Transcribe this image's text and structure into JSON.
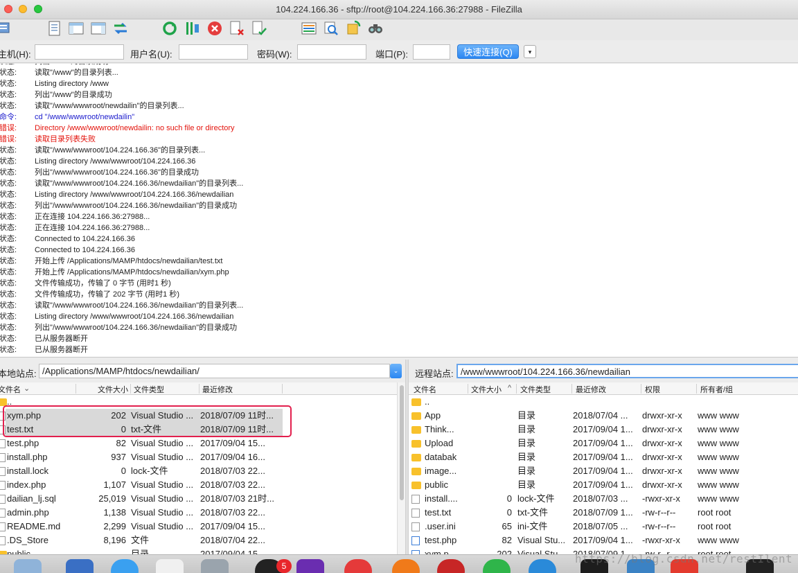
{
  "window": {
    "title": "104.224.166.36 - sftp://root@104.224.166.36:27988 - FileZilla"
  },
  "toolbar": {
    "icons": [
      "site-manager-icon",
      "message-log-icon",
      "local-tree-icon",
      "remote-tree-icon",
      "transfer-queue-icon",
      "refresh-icon",
      "process-queue-icon",
      "cancel-icon",
      "disconnect-icon",
      "reconnect-icon",
      "filter-icon",
      "compare-icon",
      "sync-browse-icon",
      "search-icon"
    ]
  },
  "quickconnect": {
    "host_label": "主机(H):",
    "user_label": "用户名(U):",
    "pass_label": "密码(W):",
    "port_label": "端口(P):",
    "host_value": "",
    "user_value": "",
    "pass_value": "",
    "port_value": "",
    "connect_label": "快速连接(Q)",
    "dropdown_glyph": "▾"
  },
  "log": [
    {
      "type": "状态:",
      "kind": "st",
      "msg": "列出\"/root\"的目录成功"
    },
    {
      "type": "状态:",
      "kind": "st",
      "msg": "读取\"/www\"的目录列表..."
    },
    {
      "type": "状态:",
      "kind": "st",
      "msg": "Listing directory /www"
    },
    {
      "type": "状态:",
      "kind": "st",
      "msg": "列出\"/www\"的目录成功"
    },
    {
      "type": "状态:",
      "kind": "st",
      "msg": "读取\"/www/wwwroot/newdailin\"的目录列表..."
    },
    {
      "type": "命令:",
      "kind": "cmd",
      "msg": "cd \"/www/wwwroot/newdailin\""
    },
    {
      "type": "错误:",
      "kind": "err",
      "msg": "Directory /www/wwwroot/newdailin: no such file or directory"
    },
    {
      "type": "错误:",
      "kind": "err",
      "msg": "读取目录列表失败"
    },
    {
      "type": "状态:",
      "kind": "st",
      "msg": "读取\"/www/wwwroot/104.224.166.36\"的目录列表..."
    },
    {
      "type": "状态:",
      "kind": "st",
      "msg": "Listing directory /www/wwwroot/104.224.166.36"
    },
    {
      "type": "状态:",
      "kind": "st",
      "msg": "列出\"/www/wwwroot/104.224.166.36\"的目录成功"
    },
    {
      "type": "状态:",
      "kind": "st",
      "msg": "读取\"/www/wwwroot/104.224.166.36/newdailian\"的目录列表..."
    },
    {
      "type": "状态:",
      "kind": "st",
      "msg": "Listing directory /www/wwwroot/104.224.166.36/newdailian"
    },
    {
      "type": "状态:",
      "kind": "st",
      "msg": "列出\"/www/wwwroot/104.224.166.36/newdailian\"的目录成功"
    },
    {
      "type": "状态:",
      "kind": "st",
      "msg": "正在连接 104.224.166.36:27988..."
    },
    {
      "type": "状态:",
      "kind": "st",
      "msg": "正在连接 104.224.166.36:27988..."
    },
    {
      "type": "状态:",
      "kind": "st",
      "msg": "Connected to 104.224.166.36"
    },
    {
      "type": "状态:",
      "kind": "st",
      "msg": "Connected to 104.224.166.36"
    },
    {
      "type": "状态:",
      "kind": "st",
      "msg": "开始上传 /Applications/MAMP/htdocs/newdailian/test.txt"
    },
    {
      "type": "状态:",
      "kind": "st",
      "msg": "开始上传 /Applications/MAMP/htdocs/newdailian/xym.php"
    },
    {
      "type": "状态:",
      "kind": "st",
      "msg": "文件传输成功，传输了 0 字节 (用时1 秒)"
    },
    {
      "type": "状态:",
      "kind": "st",
      "msg": "文件传输成功，传输了 202 字节 (用时1 秒)"
    },
    {
      "type": "状态:",
      "kind": "st",
      "msg": "读取\"/www/wwwroot/104.224.166.36/newdailian\"的目录列表..."
    },
    {
      "type": "状态:",
      "kind": "st",
      "msg": "Listing directory /www/wwwroot/104.224.166.36/newdailian"
    },
    {
      "type": "状态:",
      "kind": "st",
      "msg": "列出\"/www/wwwroot/104.224.166.36/newdailian\"的目录成功"
    },
    {
      "type": "状态:",
      "kind": "st",
      "msg": "已从服务器断开"
    },
    {
      "type": "状态:",
      "kind": "st",
      "msg": "已从服务器断开"
    }
  ],
  "local": {
    "site_label": "本地站点:",
    "path": "/Applications/MAMP/htdocs/newdailian/",
    "dropdown_glyph": "⌄",
    "headers": {
      "name": "文件名",
      "size": "文件大小",
      "type": "文件类型",
      "modified": "最近修改",
      "sort_glyph": "⌄"
    },
    "files": [
      {
        "name": "..",
        "size": "",
        "type": "",
        "modified": "",
        "icon": "folder",
        "selected": false
      },
      {
        "name": "xym.php",
        "size": "202",
        "type": "Visual Studio ...",
        "modified": "2018/07/09 11时...",
        "icon": "doc",
        "selected": true
      },
      {
        "name": "test.txt",
        "size": "0",
        "type": "txt-文件",
        "modified": "2018/07/09 11时...",
        "icon": "doc",
        "selected": true
      },
      {
        "name": "test.php",
        "size": "82",
        "type": "Visual Studio ...",
        "modified": "2017/09/04 15...",
        "icon": "doc",
        "selected": false
      },
      {
        "name": "install.php",
        "size": "937",
        "type": "Visual Studio ...",
        "modified": "2017/09/04 16...",
        "icon": "doc",
        "selected": false
      },
      {
        "name": "install.lock",
        "size": "0",
        "type": "lock-文件",
        "modified": "2018/07/03 22...",
        "icon": "doc",
        "selected": false
      },
      {
        "name": "index.php",
        "size": "1,107",
        "type": "Visual Studio ...",
        "modified": "2018/07/03 22...",
        "icon": "doc",
        "selected": false
      },
      {
        "name": "dailian_lj.sql",
        "size": "25,019",
        "type": "Visual Studio ...",
        "modified": "2018/07/03 21时...",
        "icon": "doc",
        "selected": false
      },
      {
        "name": "admin.php",
        "size": "1,138",
        "type": "Visual Studio ...",
        "modified": "2018/07/03 22...",
        "icon": "doc",
        "selected": false
      },
      {
        "name": "README.md",
        "size": "2,299",
        "type": "Visual Studio ...",
        "modified": "2017/09/04 15...",
        "icon": "doc",
        "selected": false
      },
      {
        "name": ".DS_Store",
        "size": "8,196",
        "type": "文件",
        "modified": "2018/07/04 22...",
        "icon": "doc",
        "selected": false
      },
      {
        "name": "public",
        "size": "",
        "type": "目录",
        "modified": "2017/09/04 15...",
        "icon": "folder",
        "selected": false
      }
    ]
  },
  "remote": {
    "site_label": "远程站点:",
    "path": "/www/wwwroot/104.224.166.36/newdailian",
    "headers": {
      "name": "文件名",
      "size": "文件大小",
      "type": "文件类型",
      "modified": "最近修改",
      "perms": "权限",
      "owner": "所有者/组",
      "sort_glyph": "^"
    },
    "files": [
      {
        "name": "..",
        "size": "",
        "type": "",
        "modified": "",
        "perms": "",
        "owner": "",
        "icon": "folder"
      },
      {
        "name": "App",
        "size": "",
        "type": "目录",
        "modified": "2018/07/04 ...",
        "perms": "drwxr-xr-x",
        "owner": "www www",
        "icon": "folder"
      },
      {
        "name": "Think...",
        "size": "",
        "type": "目录",
        "modified": "2017/09/04 1...",
        "perms": "drwxr-xr-x",
        "owner": "www www",
        "icon": "folder"
      },
      {
        "name": "Upload",
        "size": "",
        "type": "目录",
        "modified": "2017/09/04 1...",
        "perms": "drwxr-xr-x",
        "owner": "www www",
        "icon": "folder"
      },
      {
        "name": "databak",
        "size": "",
        "type": "目录",
        "modified": "2017/09/04 1...",
        "perms": "drwxr-xr-x",
        "owner": "www www",
        "icon": "folder"
      },
      {
        "name": "image...",
        "size": "",
        "type": "目录",
        "modified": "2017/09/04 1...",
        "perms": "drwxr-xr-x",
        "owner": "www www",
        "icon": "folder"
      },
      {
        "name": "public",
        "size": "",
        "type": "目录",
        "modified": "2017/09/04 1...",
        "perms": "drwxr-xr-x",
        "owner": "www www",
        "icon": "folder"
      },
      {
        "name": "install....",
        "size": "0",
        "type": "lock-文件",
        "modified": "2018/07/03 ...",
        "perms": "-rwxr-xr-x",
        "owner": "www www",
        "icon": "doc"
      },
      {
        "name": "test.txt",
        "size": "0",
        "type": "txt-文件",
        "modified": "2018/07/09 1...",
        "perms": "-rw-r--r--",
        "owner": "root root",
        "icon": "doc"
      },
      {
        "name": ".user.ini",
        "size": "65",
        "type": "ini-文件",
        "modified": "2018/07/05 ...",
        "perms": "-rw-r--r--",
        "owner": "root root",
        "icon": "doc"
      },
      {
        "name": "test.php",
        "size": "82",
        "type": "Visual Stu...",
        "modified": "2017/09/04 1...",
        "perms": "-rwxr-xr-x",
        "owner": "www www",
        "icon": "vsdoc"
      },
      {
        "name": "xym.p...",
        "size": "202",
        "type": "Visual Stu...",
        "modified": "2018/07/09 1...",
        "perms": "-rw-r--r--",
        "owner": "root root",
        "icon": "vsdoc"
      }
    ]
  },
  "dock": {
    "badge": "5",
    "watermark": "https://blog.csdn.net/restIlent"
  },
  "colors": {
    "error": "#e3120b",
    "command": "#1a1acc",
    "accent": "#2a86f2",
    "highlight_border": "#e21f4d"
  }
}
